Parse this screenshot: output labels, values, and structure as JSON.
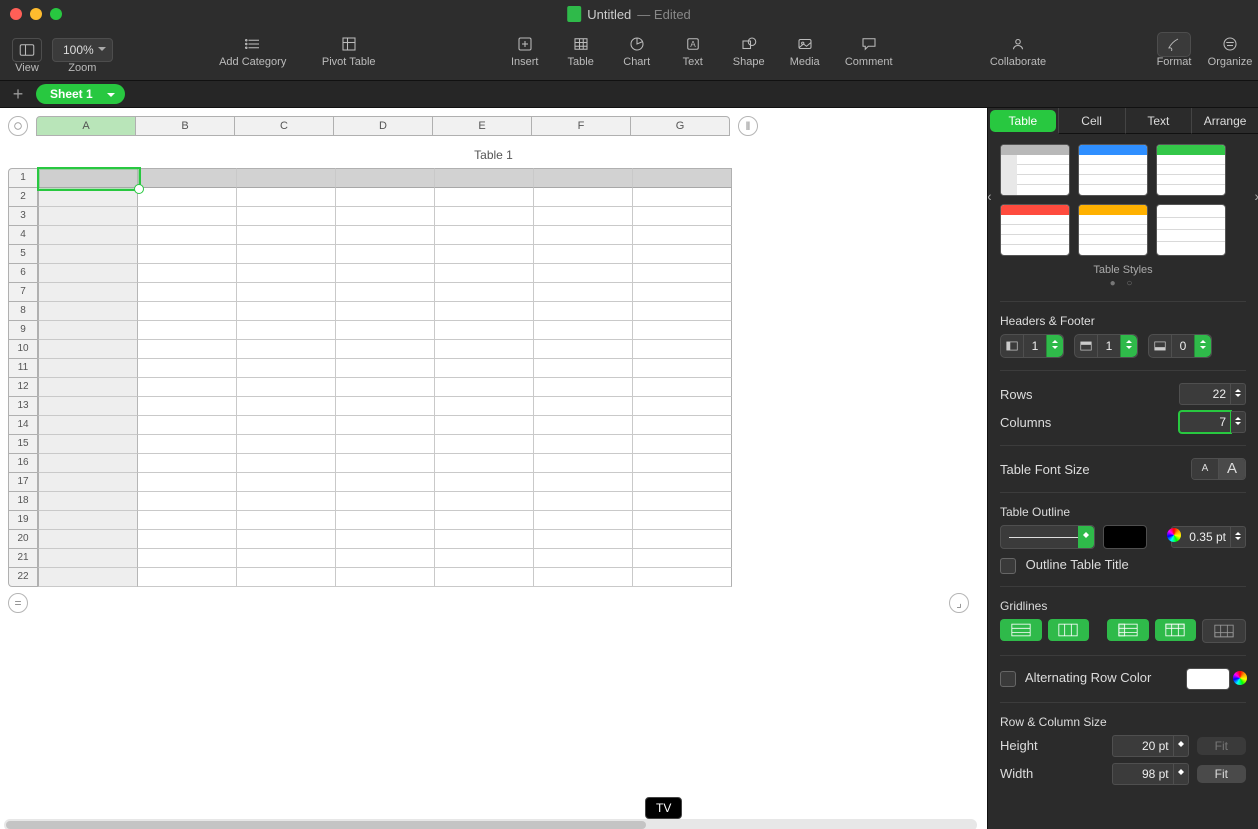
{
  "window": {
    "title": "Untitled",
    "status": "Edited"
  },
  "toolbar": {
    "zoom": "100%",
    "items": {
      "view": "View",
      "zoom": "Zoom",
      "add_category": "Add Category",
      "pivot_table": "Pivot Table",
      "insert": "Insert",
      "table": "Table",
      "chart": "Chart",
      "text": "Text",
      "shape": "Shape",
      "media": "Media",
      "comment": "Comment",
      "collaborate": "Collaborate",
      "format": "Format",
      "organize": "Organize"
    }
  },
  "sheets": {
    "active": "Sheet 1"
  },
  "spreadsheet": {
    "title": "Table 1",
    "columns": [
      "A",
      "B",
      "C",
      "D",
      "E",
      "F",
      "G"
    ],
    "rows": [
      "1",
      "2",
      "3",
      "4",
      "5",
      "6",
      "7",
      "8",
      "9",
      "10",
      "11",
      "12",
      "13",
      "14",
      "15",
      "16",
      "17",
      "18",
      "19",
      "20",
      "21",
      "22"
    ],
    "selected_cell": "A1"
  },
  "tooltip": "TV",
  "inspector": {
    "tabs": {
      "table": "Table",
      "cell": "Cell",
      "text": "Text",
      "arrange": "Arrange"
    },
    "table_styles_caption": "Table Styles",
    "headers_footer": {
      "title": "Headers & Footer",
      "header_cols": "1",
      "header_rows": "1",
      "footer_rows": "0"
    },
    "rows": {
      "label": "Rows",
      "value": "22"
    },
    "columns": {
      "label": "Columns",
      "value": "7"
    },
    "font_size_label": "Table Font Size",
    "outline": {
      "label": "Table Outline",
      "width": "0.35 pt",
      "title_checkbox": "Outline Table Title"
    },
    "gridlines_label": "Gridlines",
    "alt_row_label": "Alternating Row Color",
    "row_col_size": {
      "title": "Row & Column Size",
      "height_label": "Height",
      "height": "20 pt",
      "width_label": "Width",
      "width": "98 pt",
      "fit": "Fit"
    }
  }
}
